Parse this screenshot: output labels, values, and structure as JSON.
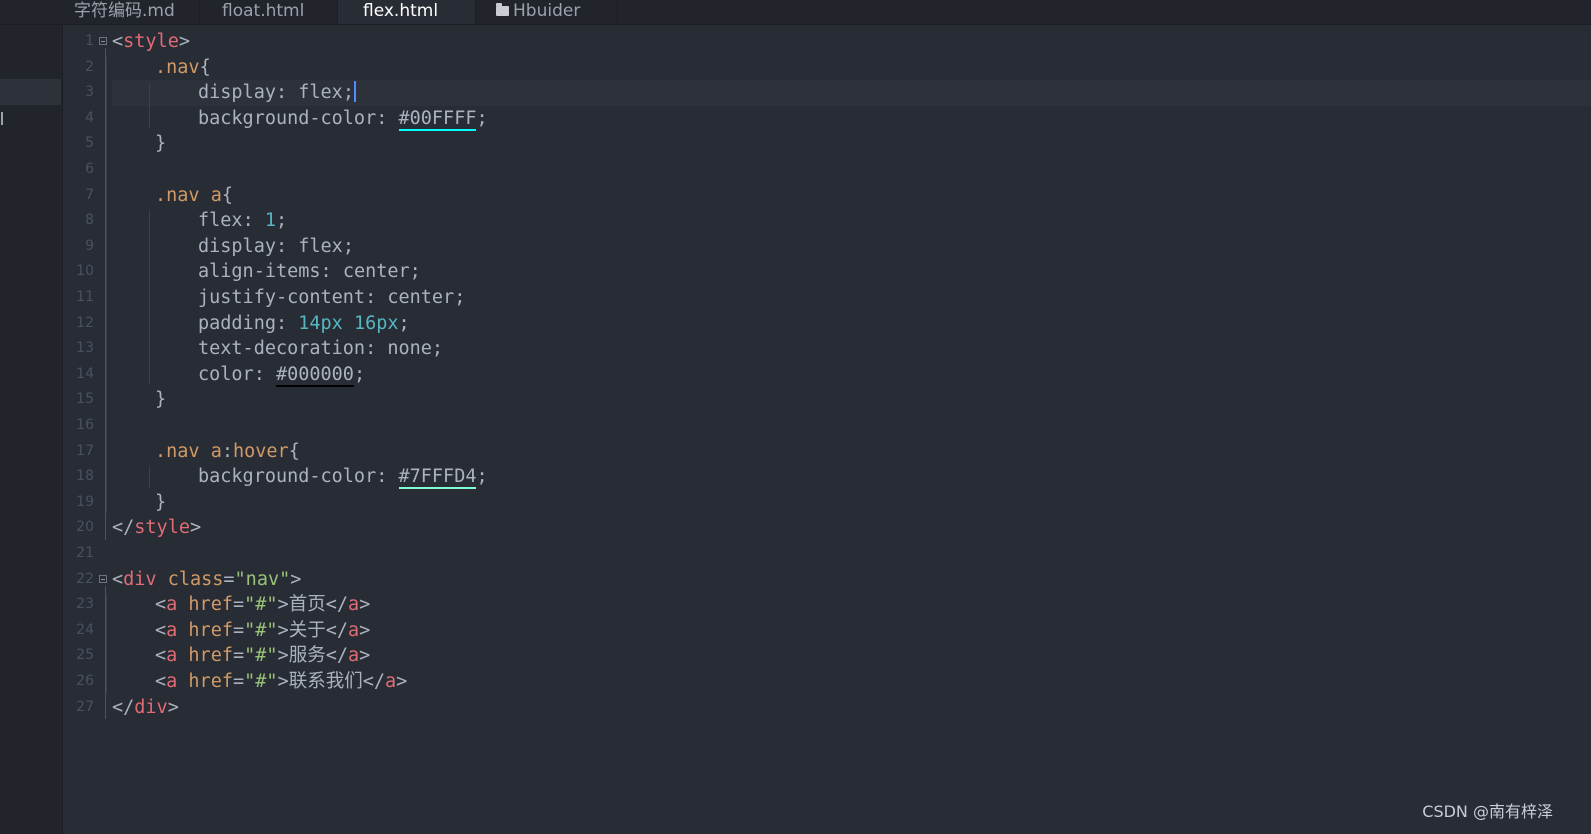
{
  "tabs": [
    {
      "label": "字符编码.md",
      "active": false
    },
    {
      "label": "float.html",
      "active": false
    },
    {
      "label": "flex.html",
      "active": true
    },
    {
      "label": "Hbuider",
      "active": false,
      "icon": "folder-icon"
    }
  ],
  "editor": {
    "current_line": 3,
    "cursor_line": 3,
    "lines": [
      {
        "n": "1",
        "fold": true,
        "indent": 0,
        "tokens": [
          [
            "punc",
            "<"
          ],
          [
            "tag",
            "style"
          ],
          [
            "punc",
            ">"
          ]
        ]
      },
      {
        "n": "2",
        "indent": 1,
        "tokens": [
          [
            "sel",
            ".nav"
          ],
          [
            "punc",
            "{"
          ]
        ]
      },
      {
        "n": "3",
        "indent": 2,
        "tokens": [
          [
            "prop",
            "display"
          ],
          [
            "punc",
            ": "
          ],
          [
            "val",
            "flex"
          ],
          [
            "punc",
            ";"
          ]
        ]
      },
      {
        "n": "4",
        "indent": 2,
        "tokens": [
          [
            "prop",
            "background-color"
          ],
          [
            "punc",
            ": "
          ],
          [
            "color",
            "#00FFFF"
          ],
          [
            "punc",
            ";"
          ]
        ]
      },
      {
        "n": "5",
        "indent": 1,
        "tokens": [
          [
            "punc",
            "}"
          ]
        ]
      },
      {
        "n": "6",
        "indent": 0,
        "tokens": []
      },
      {
        "n": "7",
        "indent": 1,
        "tokens": [
          [
            "sel",
            ".nav"
          ],
          [
            "punc",
            " "
          ],
          [
            "sel",
            "a"
          ],
          [
            "punc",
            "{"
          ]
        ]
      },
      {
        "n": "8",
        "indent": 2,
        "tokens": [
          [
            "prop",
            "flex"
          ],
          [
            "punc",
            ": "
          ],
          [
            "num",
            "1"
          ],
          [
            "punc",
            ";"
          ]
        ]
      },
      {
        "n": "9",
        "indent": 2,
        "tokens": [
          [
            "prop",
            "display"
          ],
          [
            "punc",
            ": "
          ],
          [
            "val",
            "flex"
          ],
          [
            "punc",
            ";"
          ]
        ]
      },
      {
        "n": "10",
        "indent": 2,
        "tokens": [
          [
            "prop",
            "align-items"
          ],
          [
            "punc",
            ": "
          ],
          [
            "val",
            "center"
          ],
          [
            "punc",
            ";"
          ]
        ]
      },
      {
        "n": "11",
        "indent": 2,
        "tokens": [
          [
            "prop",
            "justify-content"
          ],
          [
            "punc",
            ": "
          ],
          [
            "val",
            "center"
          ],
          [
            "punc",
            ";"
          ]
        ]
      },
      {
        "n": "12",
        "indent": 2,
        "tokens": [
          [
            "prop",
            "padding"
          ],
          [
            "punc",
            ": "
          ],
          [
            "num",
            "14px"
          ],
          [
            "punc",
            " "
          ],
          [
            "num",
            "16px"
          ],
          [
            "punc",
            ";"
          ]
        ]
      },
      {
        "n": "13",
        "indent": 2,
        "tokens": [
          [
            "prop",
            "text-decoration"
          ],
          [
            "punc",
            ": "
          ],
          [
            "val",
            "none"
          ],
          [
            "punc",
            ";"
          ]
        ]
      },
      {
        "n": "14",
        "indent": 2,
        "tokens": [
          [
            "prop",
            "color"
          ],
          [
            "punc",
            ": "
          ],
          [
            "color",
            "#000000"
          ],
          [
            "punc",
            ";"
          ]
        ]
      },
      {
        "n": "15",
        "indent": 1,
        "tokens": [
          [
            "punc",
            "}"
          ]
        ]
      },
      {
        "n": "16",
        "indent": 0,
        "tokens": []
      },
      {
        "n": "17",
        "indent": 1,
        "tokens": [
          [
            "sel",
            ".nav"
          ],
          [
            "punc",
            " "
          ],
          [
            "sel",
            "a"
          ],
          [
            "punc",
            ":"
          ],
          [
            "sel",
            "hover"
          ],
          [
            "punc",
            "{"
          ]
        ]
      },
      {
        "n": "18",
        "indent": 2,
        "tokens": [
          [
            "prop",
            "background-color"
          ],
          [
            "punc",
            ": "
          ],
          [
            "color",
            "#7FFFD4"
          ],
          [
            "punc",
            ";"
          ]
        ]
      },
      {
        "n": "19",
        "indent": 1,
        "tokens": [
          [
            "punc",
            "}"
          ]
        ]
      },
      {
        "n": "20",
        "indent": 0,
        "tokens": [
          [
            "punc",
            "</"
          ],
          [
            "tag",
            "style"
          ],
          [
            "punc",
            ">"
          ]
        ]
      },
      {
        "n": "21",
        "indent": 0,
        "tokens": []
      },
      {
        "n": "22",
        "fold": true,
        "indent": 0,
        "tokens": [
          [
            "punc",
            "<"
          ],
          [
            "tag",
            "div"
          ],
          [
            "punc",
            " "
          ],
          [
            "attr",
            "class"
          ],
          [
            "punc",
            "="
          ],
          [
            "str",
            "\"nav\""
          ],
          [
            "punc",
            ">"
          ]
        ]
      },
      {
        "n": "23",
        "indent": 1,
        "tokens": [
          [
            "punc",
            "<"
          ],
          [
            "tag",
            "a"
          ],
          [
            "punc",
            " "
          ],
          [
            "attr",
            "href"
          ],
          [
            "punc",
            "="
          ],
          [
            "str",
            "\"#\""
          ],
          [
            "punc",
            ">"
          ],
          [
            "text",
            "首页"
          ],
          [
            "punc",
            "</"
          ],
          [
            "tag",
            "a"
          ],
          [
            "punc",
            ">"
          ]
        ]
      },
      {
        "n": "24",
        "indent": 1,
        "tokens": [
          [
            "punc",
            "<"
          ],
          [
            "tag",
            "a"
          ],
          [
            "punc",
            " "
          ],
          [
            "attr",
            "href"
          ],
          [
            "punc",
            "="
          ],
          [
            "str",
            "\"#\""
          ],
          [
            "punc",
            ">"
          ],
          [
            "text",
            "关于"
          ],
          [
            "punc",
            "</"
          ],
          [
            "tag",
            "a"
          ],
          [
            "punc",
            ">"
          ]
        ]
      },
      {
        "n": "25",
        "indent": 1,
        "tokens": [
          [
            "punc",
            "<"
          ],
          [
            "tag",
            "a"
          ],
          [
            "punc",
            " "
          ],
          [
            "attr",
            "href"
          ],
          [
            "punc",
            "="
          ],
          [
            "str",
            "\"#\""
          ],
          [
            "punc",
            ">"
          ],
          [
            "text",
            "服务"
          ],
          [
            "punc",
            "</"
          ],
          [
            "tag",
            "a"
          ],
          [
            "punc",
            ">"
          ]
        ]
      },
      {
        "n": "26",
        "indent": 1,
        "tokens": [
          [
            "punc",
            "<"
          ],
          [
            "tag",
            "a"
          ],
          [
            "punc",
            " "
          ],
          [
            "attr",
            "href"
          ],
          [
            "punc",
            "="
          ],
          [
            "str",
            "\"#\""
          ],
          [
            "punc",
            ">"
          ],
          [
            "text",
            "联系我们"
          ],
          [
            "punc",
            "</"
          ],
          [
            "tag",
            "a"
          ],
          [
            "punc",
            ">"
          ]
        ]
      },
      {
        "n": "27",
        "indent": 0,
        "tokens": [
          [
            "punc",
            "</"
          ],
          [
            "tag",
            "div"
          ],
          [
            "punc",
            ">"
          ]
        ]
      }
    ]
  },
  "watermark": "CSDN @南有梓泽",
  "colors": {
    "background": "#282c34",
    "sidebar": "#21252b",
    "tag": "#e06c75",
    "attribute": "#d19a66",
    "string": "#98c379",
    "number": "#56b6c2",
    "cursor": "#528bff",
    "swatch_00FFFF": "#00FFFF",
    "swatch_000000": "#000000",
    "swatch_7FFFD4": "#7FFFD4"
  }
}
